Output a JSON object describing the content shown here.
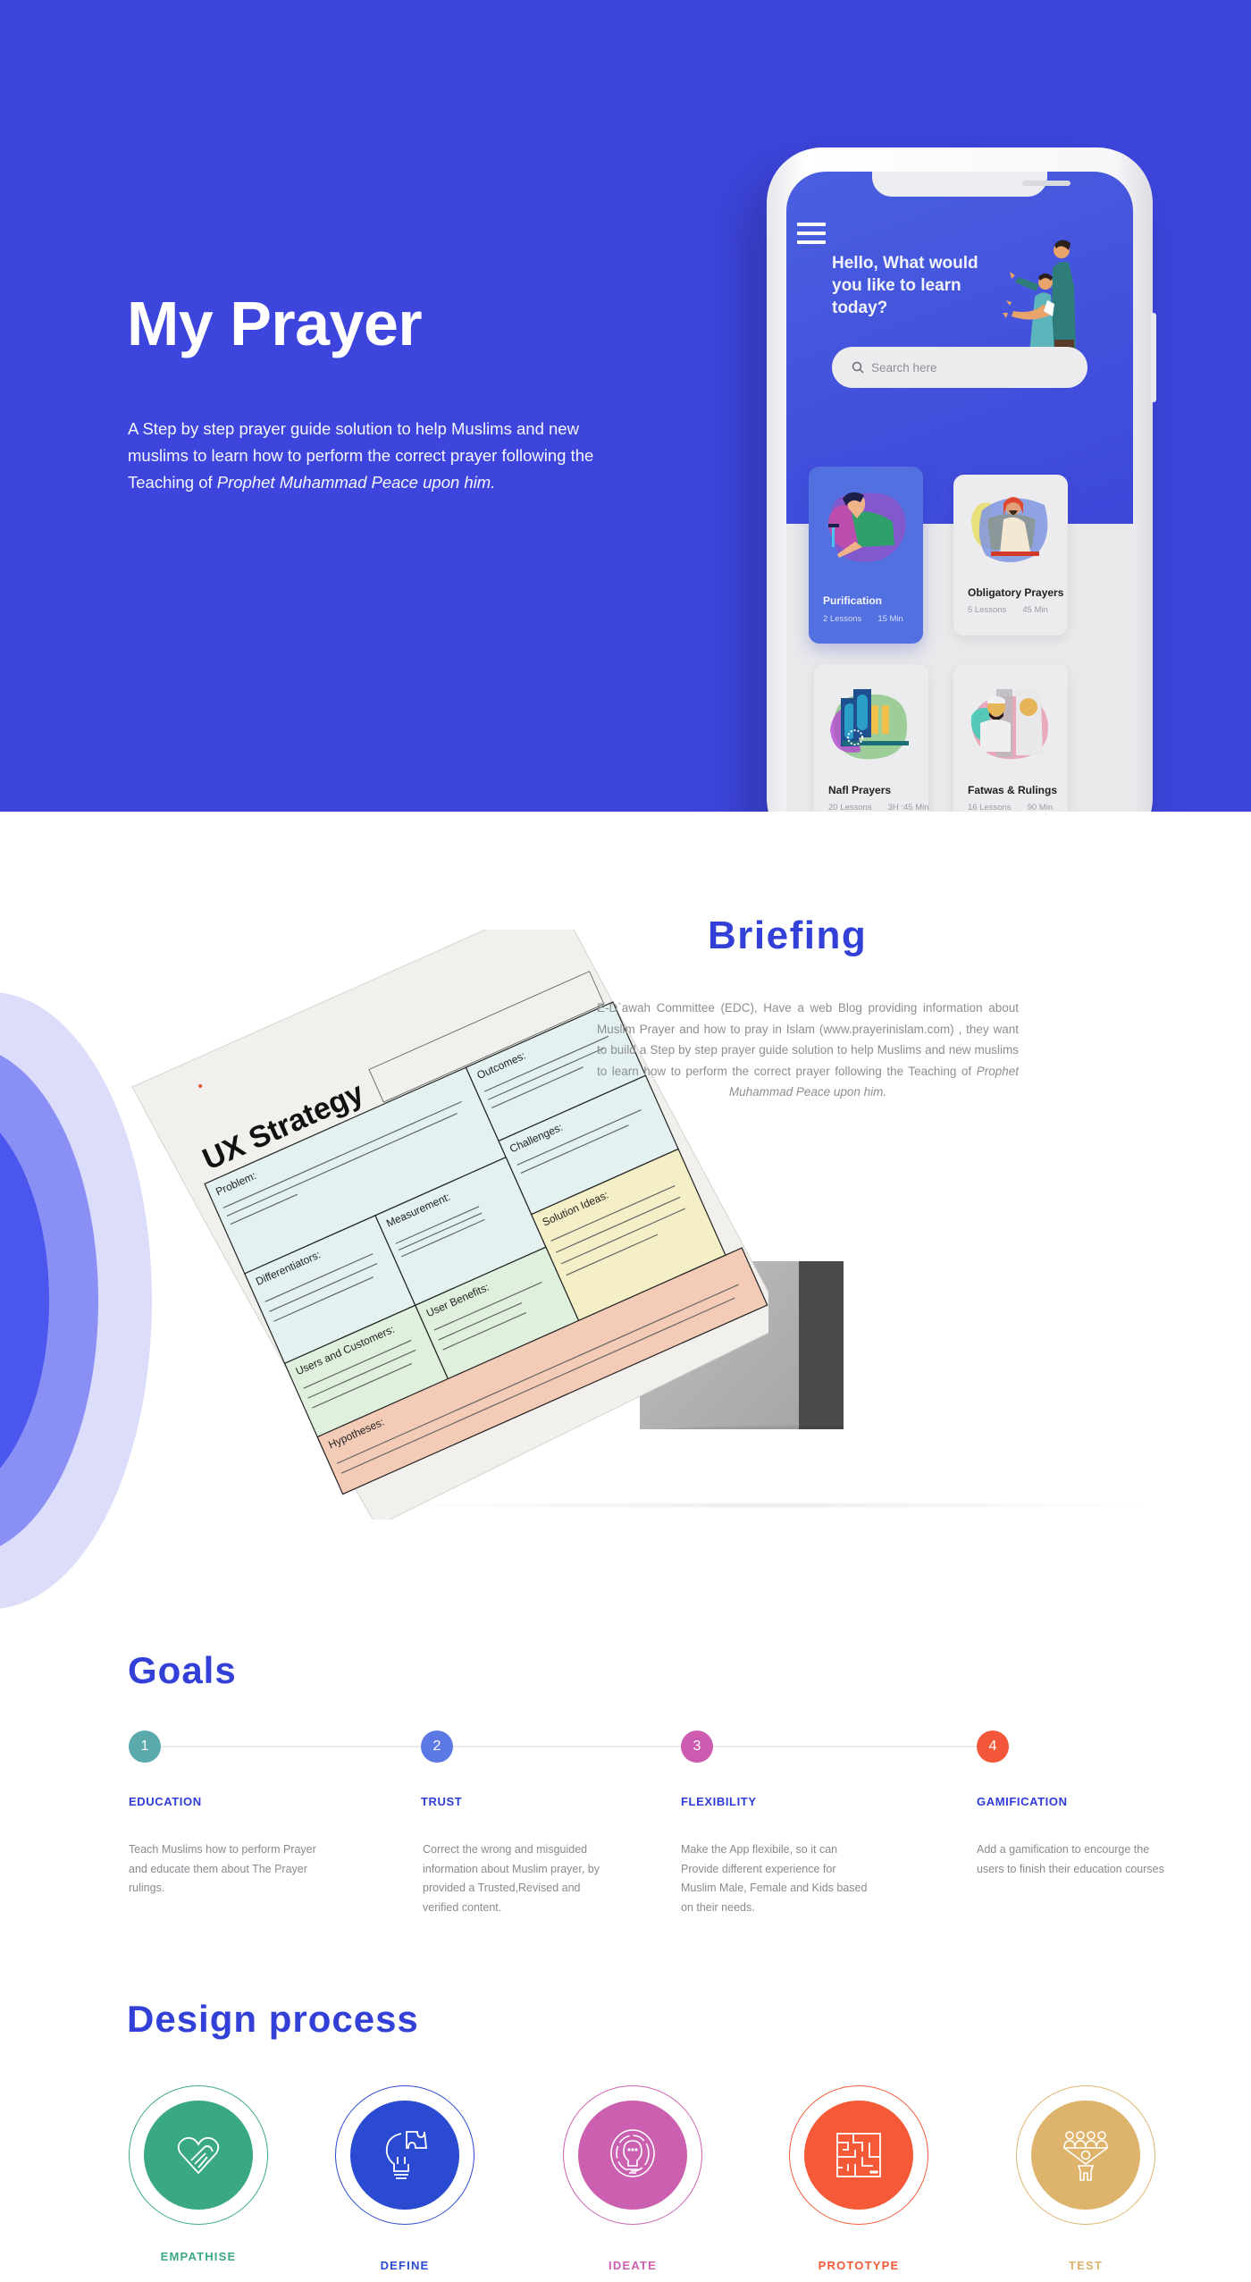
{
  "hero": {
    "title": "My Prayer",
    "description_plain": "A Step by step prayer guide solution to help Muslims and new muslims to learn how to perform the correct prayer following the Teaching of ",
    "description_italic": "Prophet Muhammad Peace upon him.",
    "background_color": "#3d45dc"
  },
  "app": {
    "greeting": "Hello, What would you like to learn today?",
    "search_placeholder": "Search here",
    "menu_icon": "hamburger-menu-icon",
    "cards": [
      {
        "title": "Purification",
        "lessons": "2 Lessons",
        "duration": "15 Min",
        "active": true,
        "illustration": "person-washing-icon"
      },
      {
        "title": "Obligatory Prayers",
        "lessons": "5 Lessons",
        "duration": "45 Min",
        "active": false,
        "illustration": "man-praying-icon"
      },
      {
        "title": "Nafl Prayers",
        "lessons": "20 Lessons",
        "duration": "3H :45 Min",
        "active": false,
        "illustration": "prayer-rug-hands-icon"
      },
      {
        "title": "Fatwas & Rulings",
        "lessons": "16 Lessons",
        "duration": "90 Min",
        "active": false,
        "illustration": "man-woman-icon"
      }
    ]
  },
  "briefing": {
    "title": "Briefing",
    "text_plain": "E-D`awah Committee (EDC), Have a web Blog providing information about Muslim Prayer and how to pray in Islam (www.prayerinislam.com) , they want to build a Step by step prayer guide solution to help Muslims and new muslims to learn how to perform the correct prayer following the Teaching of ",
    "text_italic": "Prophet Muhammad Peace upon him."
  },
  "ux_strategy_doc": {
    "title": "UX Strategy",
    "intro": "E-D`awah Committee (EDC), Have a web Blog providing information about Muslim Prayer and how to pray in Islam (www.prayerinislam.com), they want to build a Step by step prayer guide solution to help Muslims and new muslims to learn how to perform the correct prayer following the Teaching of Prophet Muhammad Peace upon him.",
    "sections": [
      {
        "heading": "Problem:",
        "body": "Muslims arround the world struggles to Learn about their prayer and purification rulings online, because of complexity and unorganized content."
      },
      {
        "heading": "Outcomes:",
        "body": "Users Complete the educational Lessons. Raise Muslims awareness about the importance of Prayer."
      },
      {
        "heading": "Challenges:",
        "body": "- Recording High quality explainatory Videos. - Creating a visual fun experience for Kids."
      },
      {
        "heading": "Measurement:",
        "body": "KPIs: - App Downloads - User Registrations - Users Finished Courses - Users Got higher ranking - Blog posts Social Media Signals - Users Post Questions"
      },
      {
        "heading": "Differentiators:",
        "body": "Contents will be easy to understand. different experience based on Gender and age (Male - Female - Kids). High quality explanatory Videos will be Sponsored by 3rd party. Visual illustrations for Kids will be sponsored by 3rd party."
      },
      {
        "heading": "Solution Ideas:",
        "body": "- Step By step Guide to Purification (Read - watch - Answer). - Step By Step Guide to Prayer (Read - watch - Answer). - Step By step guide for each Nafl Prayer (Read - watch - Answer). - Gamification. - Motivations tips and notifications. - Different experience based on Age and Gender. Each Experience will have different content."
      },
      {
        "heading": "User Benefits:",
        "body": "Better understanding for the prayer rulings. Got Educated about Nafl Prayers. Keep their Prayers in Time. Educate and teach their Kids how to Pray in ease."
      },
      {
        "heading": "Users and Customers:",
        "body": "We targeted 3 different Groups: Non-Arab Muslims who speaks English and aged 25 to 35 years old. Arab Muslims aged 18 to 28 years old. Arab and Non-Arab Muslims Kids Aged 7 to 13 years old."
      },
      {
        "heading": "Hypotheses:",
        "body": "We believe that, Raise Muslims awareness about the importance of Prayer will be achieved if Non-Arab Muslims aged 25 to 35 attains better understanding for the prayer rulings with Step by step Guide to Prayer. We believe that, Raise Muslims awareness about the importance of Prayer will be achieved if Arab Muslims aged 18 to 28 attains Got Educated about Nafl Prayers with Step by step Guide to nafl prayers."
      }
    ]
  },
  "goals": {
    "title": "Goals",
    "items": [
      {
        "number": "1",
        "title": "EDUCATION",
        "description": "Teach Muslims how to perform Prayer and  educate them about The Prayer rulings.",
        "color": "#5aa9ad"
      },
      {
        "number": "2",
        "title": "TRUST",
        "description": "Correct the wrong and misguided information about Muslim prayer, by provided a Trusted,Revised and verified content.",
        "color": "#5b78e4"
      },
      {
        "number": "3",
        "title": "FLEXIBILITY",
        "description": "Make the App flexibile, so it can Provide different experience for Muslim Male, Female and Kids based on their needs.",
        "color": "#cd5cb0"
      },
      {
        "number": "4",
        "title": "GAMIFICATION",
        "description": "Add a gamification to encourge the users to finish their education courses",
        "color": "#f2573a"
      }
    ]
  },
  "design_process": {
    "title": "Design process",
    "steps": [
      {
        "label": "EMPATHISE",
        "icon": "heart-handshake-icon",
        "color": "#3aa883"
      },
      {
        "label": "DEFINE",
        "icon": "puzzle-lightbulb-icon",
        "color": "#2b4ad2"
      },
      {
        "label": "IDEATE",
        "icon": "lightbulb-maze-icon",
        "color": "#cc60b0"
      },
      {
        "label": "PROTOTYPE",
        "icon": "maze-grid-icon",
        "color": "#f45a38"
      },
      {
        "label": "TEST",
        "icon": "user-group-icon",
        "color": "#deb36c"
      }
    ]
  }
}
